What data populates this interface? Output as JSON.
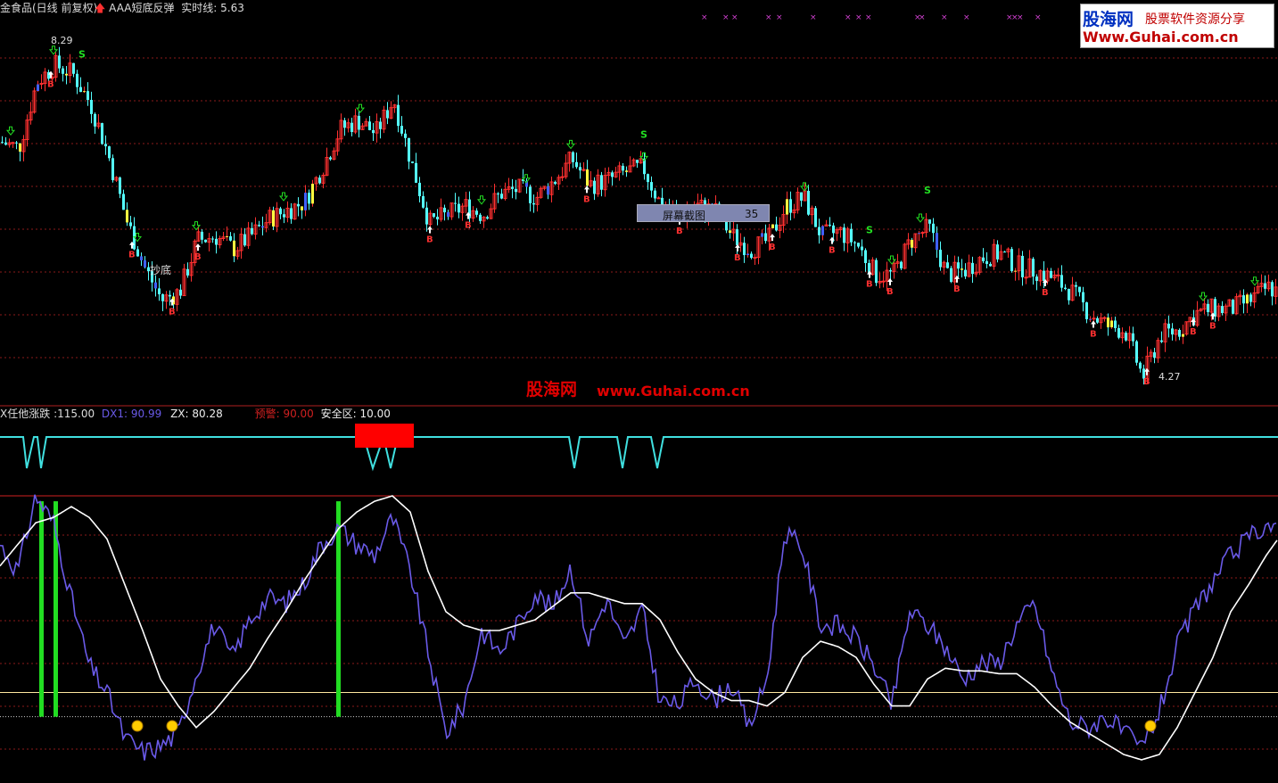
{
  "header": {
    "title": "金食品(日线 前复权)",
    "indicator_name": "AAA短底反弹",
    "realtime_label": "实时线:",
    "realtime_value": "5.63"
  },
  "logo": {
    "brand": "股海网",
    "slogan": "股票软件资源分享",
    "url": "Www.Guhai.com.cn"
  },
  "watermark": {
    "brand": "股海网",
    "url": "www.Guhai.com.cn"
  },
  "popup": {
    "label": "屏幕截图",
    "value": "35"
  },
  "price_annotations": {
    "high": "8.29",
    "low": "4.27",
    "bottom_tag": "抄底",
    "buy_mark": "B",
    "sell_mark": "S"
  },
  "indicator_header": {
    "name": "X任他涨跌",
    "name_value": ":115.00",
    "dx1_label": "DX1:",
    "dx1_value": "90.99",
    "zx_label": "ZX:",
    "zx_value": "80.28",
    "warn_label": "预警:",
    "warn_value": "90.00",
    "safe_label": "安全区:",
    "safe_value": "10.00"
  },
  "colors": {
    "up": "#ff3030",
    "down": "#54ffff",
    "dx1": "#6a5ae8",
    "zx": "#ffffff",
    "signal": "#40e0e0",
    "warn_line": "#d02020",
    "safe_line": "#ffe8a0",
    "green_bar": "#22dd22",
    "alert_block": "#ff0000",
    "grid": "#8b1a1a"
  },
  "chart_data": [
    {
      "type": "line",
      "name": "price",
      "x": [
        0,
        20,
        40,
        60,
        80,
        100,
        120,
        140,
        160,
        180,
        200,
        220,
        240,
        260,
        280,
        300,
        320,
        340,
        360,
        380,
        400,
        420,
        440,
        460,
        480,
        500,
        520,
        540,
        560,
        580,
        600,
        620,
        640,
        660,
        680,
        700,
        720,
        740,
        760,
        780,
        800,
        820,
        840,
        860,
        880,
        900,
        920,
        940,
        960,
        980,
        1000,
        1020,
        1040,
        1060,
        1080,
        1100,
        1120,
        1140,
        1160,
        1180,
        1200,
        1220,
        1240,
        1260,
        1280,
        1300,
        1320,
        1340,
        1360,
        1380,
        1400,
        1420,
        1433
      ],
      "values": [
        7.05,
        6.98,
        7.75,
        7.95,
        7.85,
        7.5,
        6.9,
        6.15,
        5.6,
        5.2,
        5.3,
        5.9,
        5.95,
        5.8,
        5.95,
        6.15,
        6.25,
        6.35,
        6.75,
        7.2,
        7.3,
        7.15,
        7.55,
        6.8,
        6.1,
        6.2,
        6.3,
        6.2,
        6.45,
        6.5,
        6.4,
        6.6,
        6.85,
        6.55,
        6.6,
        6.7,
        6.75,
        6.3,
        6.2,
        6.3,
        6.25,
        5.95,
        5.8,
        5.9,
        6.3,
        6.4,
        5.95,
        6.0,
        5.85,
        5.5,
        5.5,
        5.9,
        6.05,
        5.5,
        5.55,
        5.7,
        5.75,
        5.6,
        5.55,
        5.45,
        5.3,
        5.05,
        4.9,
        4.85,
        4.3,
        4.8,
        4.85,
        5.05,
        5.1,
        5.1,
        5.2,
        5.35,
        5.3
      ],
      "ylim": [
        4.0,
        8.5
      ]
    },
    {
      "type": "line",
      "name": "DX1",
      "x": [
        0,
        20,
        40,
        60,
        80,
        100,
        120,
        140,
        160,
        180,
        200,
        220,
        240,
        260,
        280,
        300,
        320,
        340,
        360,
        380,
        400,
        420,
        440,
        460,
        480,
        500,
        520,
        540,
        560,
        580,
        600,
        620,
        640,
        660,
        680,
        700,
        720,
        740,
        760,
        780,
        800,
        820,
        840,
        860,
        880,
        900,
        920,
        940,
        960,
        980,
        1000,
        1020,
        1040,
        1060,
        1080,
        1100,
        1120,
        1140,
        1160,
        1180,
        1200,
        1220,
        1240,
        1260,
        1280,
        1300,
        1320,
        1340,
        1360,
        1380,
        1400,
        1420,
        1433
      ],
      "values": [
        80,
        70,
        98,
        88,
        60,
        35,
        25,
        8,
        3,
        5,
        10,
        32,
        50,
        38,
        52,
        60,
        58,
        65,
        80,
        86,
        80,
        76,
        90,
        70,
        40,
        10,
        20,
        48,
        40,
        50,
        62,
        56,
        72,
        44,
        60,
        42,
        56,
        22,
        20,
        30,
        22,
        28,
        12,
        30,
        85,
        78,
        50,
        50,
        45,
        35,
        20,
        55,
        50,
        42,
        30,
        36,
        36,
        50,
        58,
        32,
        14,
        12,
        16,
        10,
        4,
        18,
        42,
        56,
        66,
        76,
        82,
        88,
        84
      ]
    },
    {
      "type": "line",
      "name": "ZX",
      "x": [
        0,
        20,
        40,
        60,
        80,
        100,
        120,
        140,
        160,
        180,
        200,
        220,
        240,
        260,
        280,
        300,
        320,
        340,
        360,
        380,
        400,
        420,
        440,
        460,
        480,
        500,
        520,
        540,
        560,
        580,
        600,
        620,
        640,
        660,
        680,
        700,
        720,
        740,
        760,
        780,
        800,
        820,
        840,
        860,
        880,
        900,
        920,
        940,
        960,
        980,
        1000,
        1020,
        1040,
        1060,
        1080,
        1100,
        1120,
        1140,
        1160,
        1180,
        1200,
        1220,
        1240,
        1260,
        1280,
        1300,
        1320,
        1340,
        1360,
        1380,
        1400,
        1420,
        1433
      ],
      "values": [
        72,
        80,
        88,
        90,
        94,
        90,
        82,
        65,
        48,
        30,
        20,
        12,
        18,
        26,
        34,
        45,
        55,
        66,
        76,
        86,
        92,
        96,
        98,
        92,
        70,
        55,
        50,
        48,
        48,
        50,
        52,
        57,
        62,
        62,
        60,
        58,
        58,
        52,
        40,
        30,
        25,
        22,
        22,
        20,
        25,
        38,
        44,
        42,
        38,
        28,
        20,
        20,
        30,
        34,
        33,
        33,
        32,
        32,
        27,
        20,
        14,
        10,
        6,
        2,
        0,
        2,
        12,
        25,
        38,
        55,
        65,
        76,
        82
      ]
    }
  ]
}
